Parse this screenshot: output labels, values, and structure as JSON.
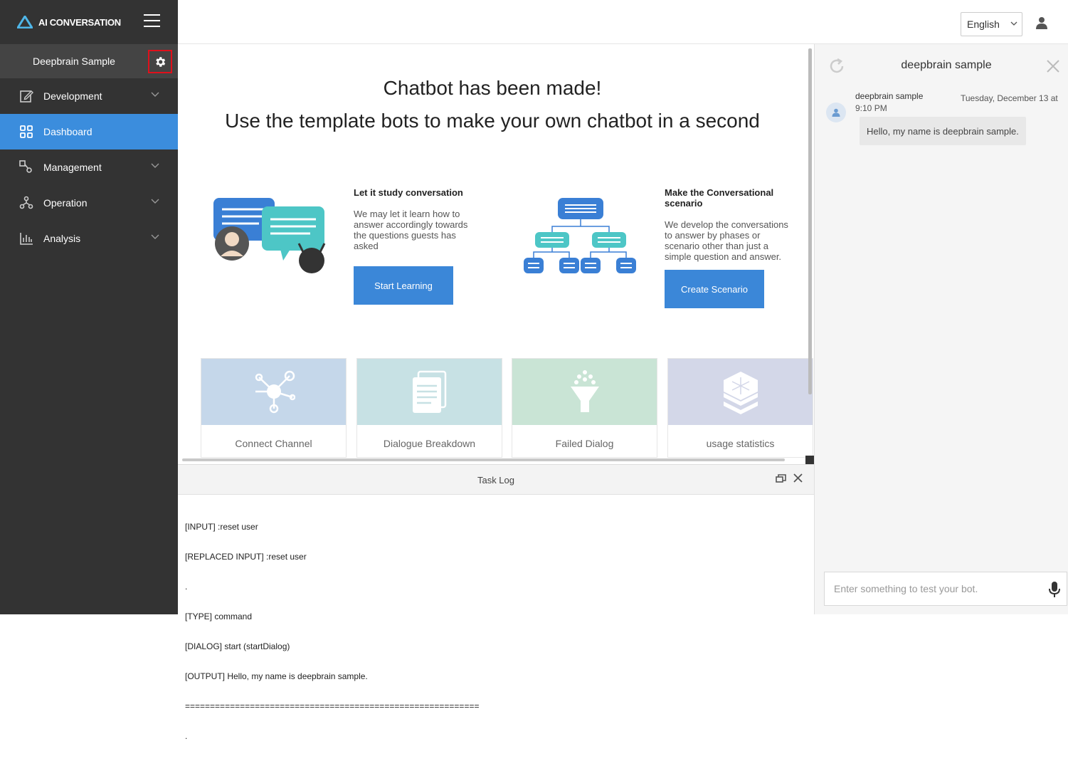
{
  "app": {
    "logo_text": "AI CONVERSATION",
    "bot_name": "Deepbrain Sample"
  },
  "sidebar": {
    "items": [
      {
        "label": "Development",
        "icon": "edit-icon",
        "expandable": true
      },
      {
        "label": "Dashboard",
        "icon": "grid-icon",
        "active": true
      },
      {
        "label": "Management",
        "icon": "management-icon",
        "expandable": true
      },
      {
        "label": "Operation",
        "icon": "operation-icon",
        "expandable": true
      },
      {
        "label": "Analysis",
        "icon": "bar-chart-icon",
        "expandable": true
      }
    ]
  },
  "header": {
    "language": "English"
  },
  "main": {
    "headline1": "Chatbot has been made!",
    "headline2": "Use the template bots to make your own chatbot in a second",
    "features": [
      {
        "title": "Let it study conversation",
        "desc_lines": [
          "We may let it learn how to",
          "answer accordingly towards",
          "the questions guests has",
          "asked"
        ],
        "button": "Start Learning"
      },
      {
        "title_lines": [
          "Make the Conversational",
          "scenario"
        ],
        "desc_lines": [
          "We develop the conversations",
          "to answer by phases or",
          "scenario other than just a",
          "simple question and answer."
        ],
        "button": "Create Scenario"
      }
    ],
    "cards": [
      {
        "label": "Connect Channel",
        "color": "#c5d7ea"
      },
      {
        "label": "Dialogue Breakdown",
        "color": "#c7e1e4"
      },
      {
        "label": "Failed Dialog",
        "color": "#c9e4d5"
      },
      {
        "label": "usage statistics",
        "color": "#d3d7e8"
      }
    ]
  },
  "tasklog": {
    "title": "Task Log",
    "lines": [
      "[INPUT] :reset user",
      "[REPLACED INPUT] :reset user",
      ".",
      "[TYPE] command",
      "[DIALOG] start (startDialog)",
      "[OUTPUT] Hello, my name is deepbrain sample.",
      "===========================================================",
      "."
    ]
  },
  "chat": {
    "title": "deepbrain sample",
    "message": {
      "sender": "deepbrain sample",
      "date": "Tuesday, December 13 at",
      "time": "9:10 PM",
      "text": "Hello, my name is deepbrain sample."
    },
    "input_placeholder": "Enter something to test your bot."
  },
  "colors": {
    "sidebar_bg": "#333333",
    "accent": "#3b8ddd",
    "highlight_border": "#e0101b"
  }
}
